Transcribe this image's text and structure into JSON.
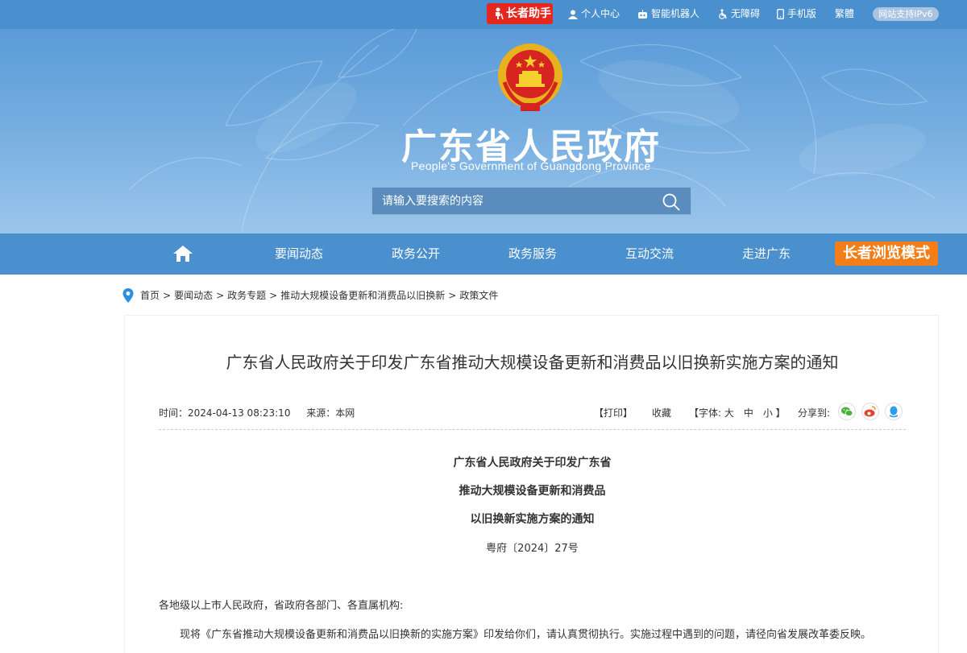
{
  "topbar": {
    "elder_assist": "长者助手",
    "links": [
      {
        "label": "个人中心",
        "icon": "user-icon"
      },
      {
        "label": "智能机器人",
        "icon": "robot-icon"
      },
      {
        "label": "无障碍",
        "icon": "accessibility-icon"
      },
      {
        "label": "手机版",
        "icon": "mobile-icon"
      },
      {
        "label": "繁體",
        "icon": ""
      }
    ],
    "ipv6": "网站支持IPv6"
  },
  "header": {
    "title": "广东省人民政府",
    "subtitle": "People's Government of Guangdong Province",
    "search_placeholder": "请输入要搜索的内容"
  },
  "nav": {
    "items": [
      "要闻动态",
      "政务公开",
      "政务服务",
      "互动交流",
      "走进广东"
    ],
    "elder_mode": "长者浏览模式"
  },
  "breadcrumb": [
    "首页",
    "要闻动态",
    "政务专题",
    "推动大规模设备更新和消费品以旧换新",
    "政策文件"
  ],
  "article": {
    "title": "广东省人民政府关于印发广东省推动大规模设备更新和消费品以旧换新实施方案的通知",
    "time": "时间：2024-04-13 08:23:10",
    "source": "来源：本网",
    "print": "【打印】",
    "favorite": "收藏",
    "font_size": "【字体: 大　中　小 】",
    "share_label": "分享到:",
    "doc_title_lines": [
      "广东省人民政府关于印发广东省",
      "推动大规模设备更新和消费品",
      "以旧换新实施方案的通知"
    ],
    "doc_number": "粤府〔2024〕27号",
    "salutation": "各地级以上市人民政府，省政府各部门、各直属机构:",
    "body": "现将《广东省推动大规模设备更新和消费品以旧换新的实施方案》印发给你们，请认真贯彻执行。实施过程中遇到的问题，请径向省发展改革委反映。"
  },
  "colors": {
    "primary": "#4a8fce",
    "elder_red": "#e5271f",
    "elder_orange": "#f37e18"
  }
}
